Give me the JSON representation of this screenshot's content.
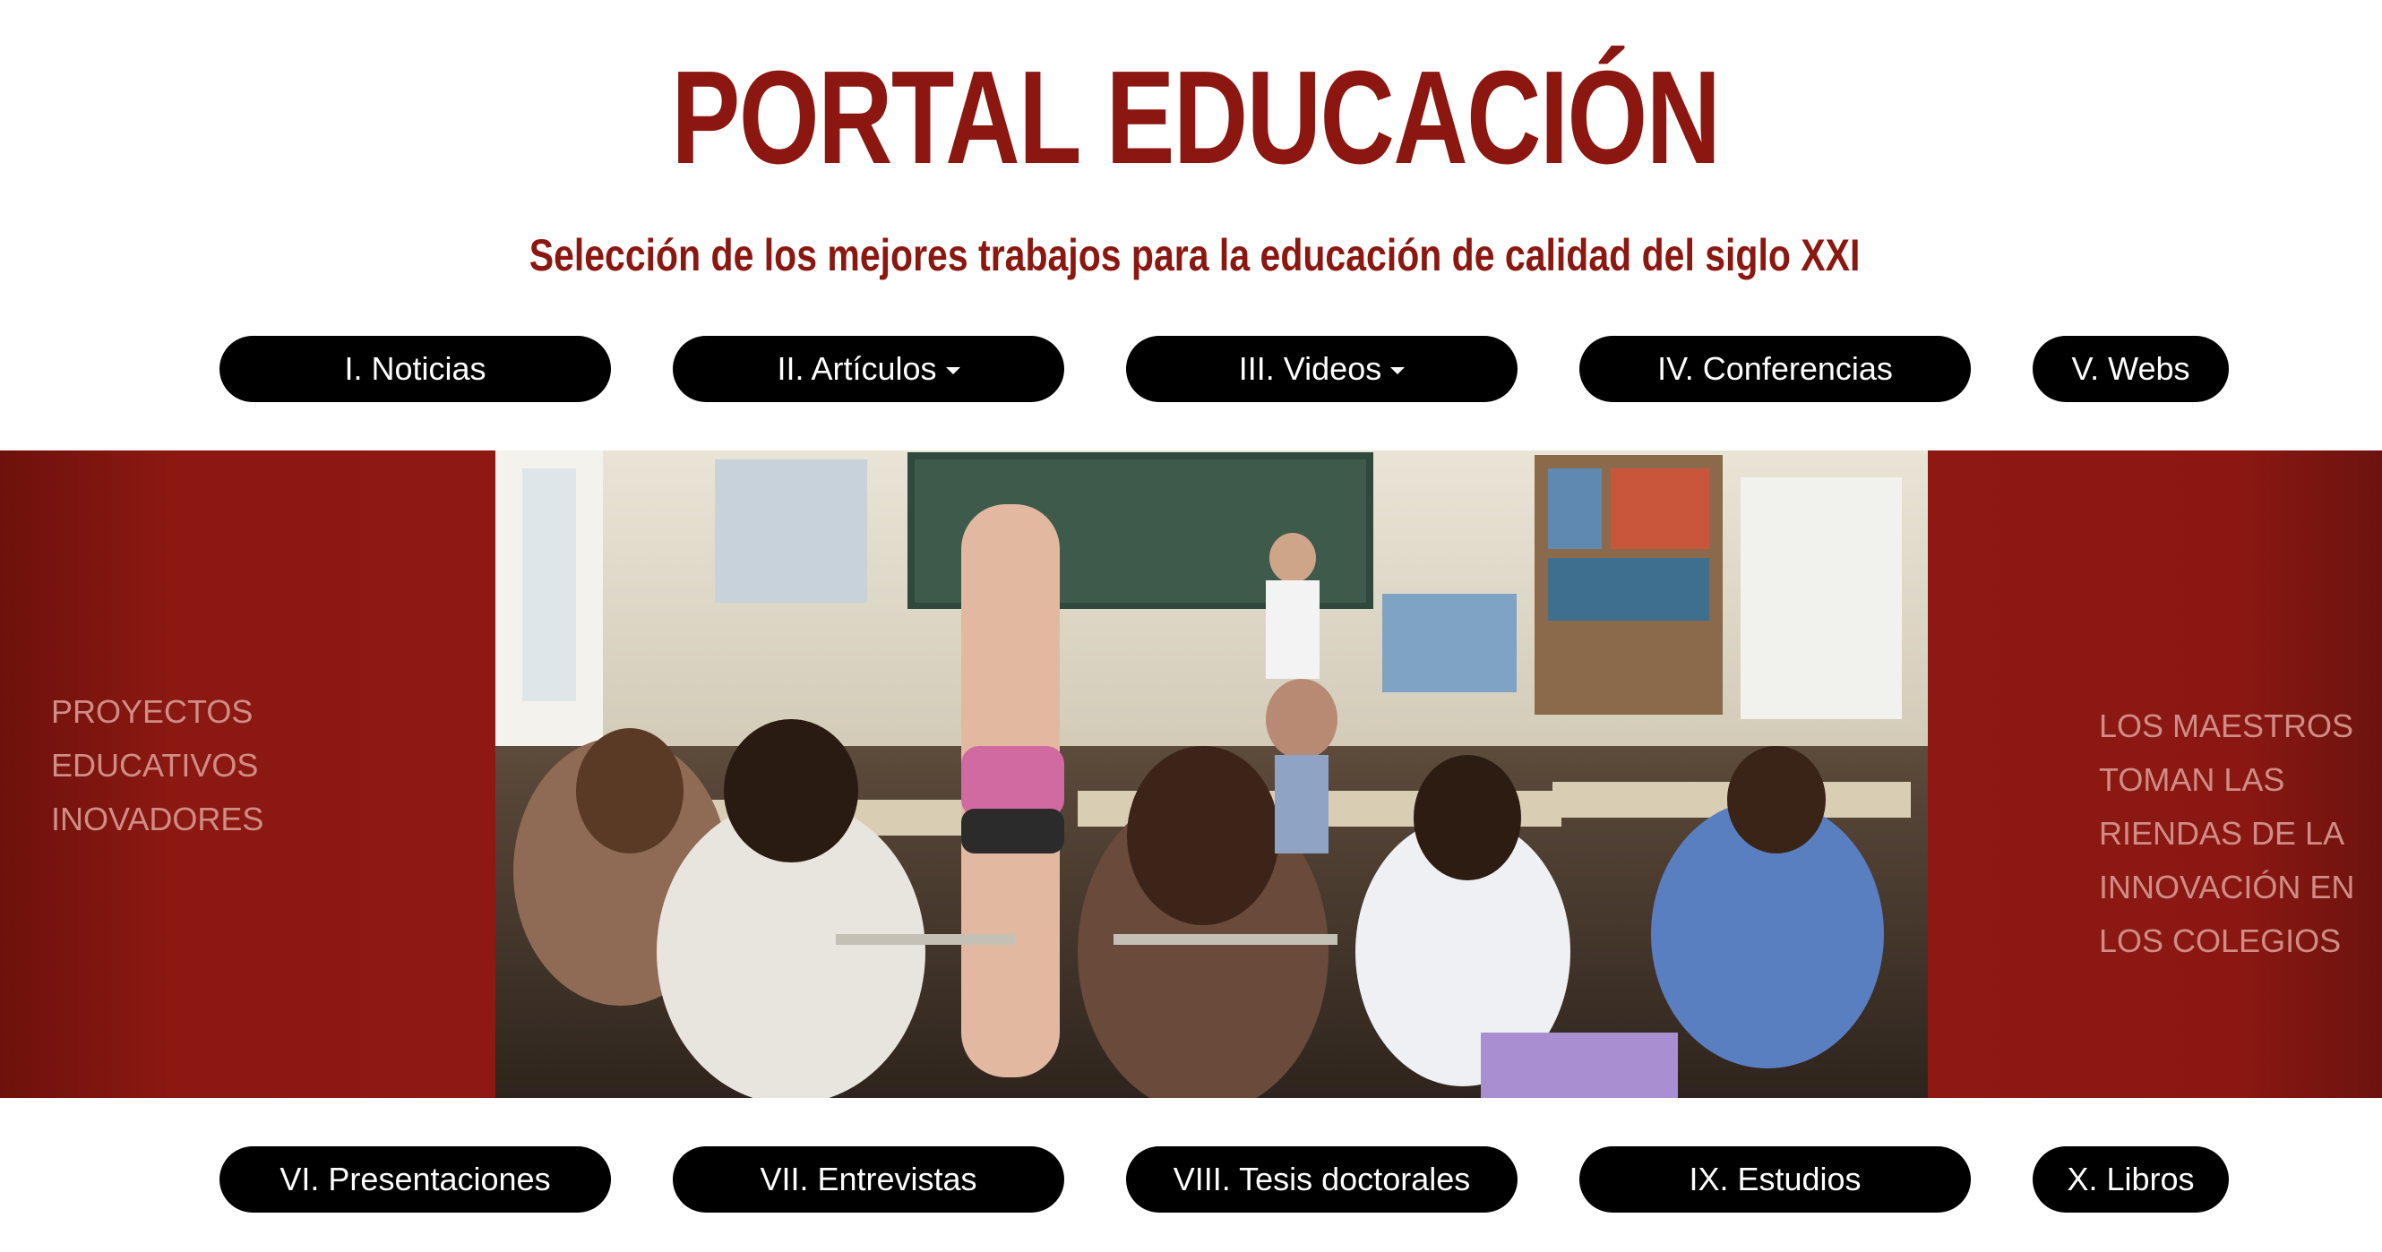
{
  "header": {
    "title": "PORTAL EDUCACIÓN",
    "subtitle": "Selección de los mejores trabajos para la educación de calidad del siglo XXI"
  },
  "nav_top": [
    {
      "label": "I. Noticias",
      "has_dropdown": false
    },
    {
      "label": "II. Artículos",
      "has_dropdown": true
    },
    {
      "label": "III. Videos",
      "has_dropdown": true
    },
    {
      "label": "IV. Conferencias",
      "has_dropdown": false
    },
    {
      "label": "V. Webs",
      "has_dropdown": false
    }
  ],
  "nav_bottom": [
    {
      "label": "VI. Presentaciones",
      "has_dropdown": false
    },
    {
      "label": "VII. Entrevistas",
      "has_dropdown": false
    },
    {
      "label": "VIII. Tesis doctorales",
      "has_dropdown": false
    },
    {
      "label": "IX. Estudios",
      "has_dropdown": false
    },
    {
      "label": "X. Libros",
      "has_dropdown": false
    }
  ],
  "banner": {
    "left_lines": [
      "PROYECTOS",
      "EDUCATIVOS",
      "INOVADORES"
    ],
    "right_lines": [
      "LOS MAESTROS",
      "TOMAN LAS",
      "RIENDAS DE LA",
      "INNOVACIÓN EN",
      "LOS COLEGIOS"
    ],
    "photo_icon": "classroom-photo"
  },
  "colors": {
    "brand_red": "#8b1710",
    "panel_red": "#8e1913",
    "panel_text": "#cf8d84",
    "button_bg": "#000000",
    "button_text": "#ffffff"
  }
}
